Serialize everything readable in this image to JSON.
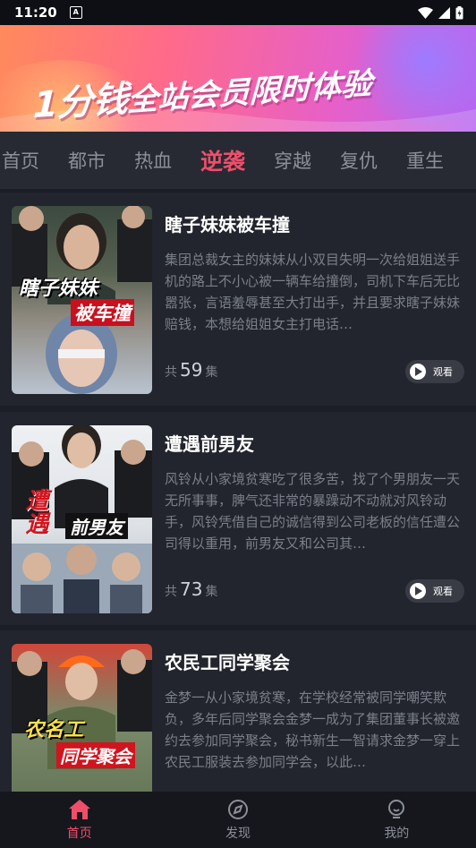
{
  "status": {
    "time": "11:20",
    "notif_icon": "A"
  },
  "banner": {
    "big": "1分钱",
    "small": "全站会员限时体验"
  },
  "tabs": [
    "首页",
    "都市",
    "热血",
    "逆袭",
    "穿越",
    "复仇",
    "重生"
  ],
  "active_tab": "逆袭",
  "cards": [
    {
      "title": "瞎子妹妹被车撞",
      "desc": "集团总裁女主的妹妹从小双目失明一次给姐姐送手机的路上不小心被一辆车给撞倒，司机下车后无比嚣张，言语羞辱甚至大打出手，并且要求瞎子妹妹赔钱，本想给姐姐女主打电话…",
      "ep_prefix": "共",
      "episodes": "59",
      "ep_suffix": "集",
      "watch": "观看",
      "thumb_caption1": "瞎子妹妹",
      "thumb_caption2": "被车撞"
    },
    {
      "title": "遭遇前男友",
      "desc": "风铃从小家境贫寒吃了很多苦，找了个男朋友一天无所事事，脾气还非常的暴躁动不动就对风铃动手，风铃凭借自己的诚信得到公司老板的信任遭公司得以重用，前男友又和公司其…",
      "ep_prefix": "共",
      "episodes": "73",
      "ep_suffix": "集",
      "watch": "观看",
      "thumb_caption1": "遭遇",
      "thumb_caption2": "前男友"
    },
    {
      "title": "农民工同学聚会",
      "desc": "金梦一从小家境贫寒，在学校经常被同学嘲笑欺负，多年后同学聚会金梦一成为了集团董事长被邀约去参加同学聚会，秘书新生一智请求金梦一穿上农民工服装去参加同学会，以此…",
      "ep_prefix": "",
      "episodes": "",
      "ep_suffix": "",
      "watch": "",
      "thumb_caption1": "农名工",
      "thumb_caption2": "同学聚会"
    }
  ],
  "nav": [
    {
      "label": "首页",
      "icon": "home-icon"
    },
    {
      "label": "发现",
      "icon": "compass-icon"
    },
    {
      "label": "我的",
      "icon": "profile-icon"
    }
  ],
  "colors": {
    "accent": "#ef4e6a",
    "background": "#1b1e26",
    "card": "#22252d"
  }
}
